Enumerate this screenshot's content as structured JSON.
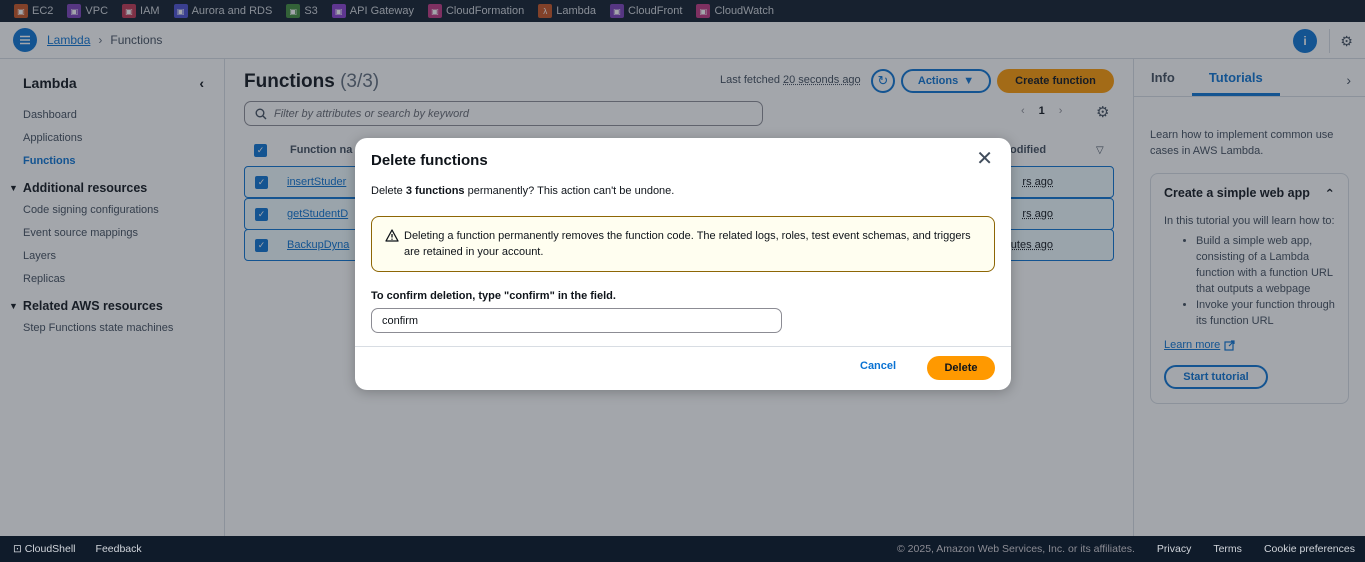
{
  "services": [
    {
      "label": "EC2",
      "icon": "ec2-icon",
      "color": "#c7511f"
    },
    {
      "label": "VPC",
      "icon": "vpc-icon",
      "color": "#7a3eb8"
    },
    {
      "label": "IAM",
      "icon": "iam-icon",
      "color": "#bf3450"
    },
    {
      "label": "Aurora and RDS",
      "icon": "rds-icon",
      "color": "#4a4fd1"
    },
    {
      "label": "S3",
      "icon": "s3-icon",
      "color": "#3e8a3a"
    },
    {
      "label": "API Gateway",
      "icon": "api-gateway-icon",
      "color": "#8a3fd1"
    },
    {
      "label": "CloudFormation",
      "icon": "cloudformation-icon",
      "color": "#bf3480"
    },
    {
      "label": "Lambda",
      "icon": "lambda-icon",
      "color": "#c7511f"
    },
    {
      "label": "CloudFront",
      "icon": "cloudfront-icon",
      "color": "#7a3eb8"
    },
    {
      "label": "CloudWatch",
      "icon": "cloudwatch-icon",
      "color": "#bf3480"
    }
  ],
  "breadcrumb": {
    "root": "Lambda",
    "current": "Functions"
  },
  "nav": {
    "title": "Lambda",
    "items": [
      "Dashboard",
      "Applications",
      "Functions"
    ],
    "active": "Functions",
    "additional_title": "Additional resources",
    "additional_items": [
      "Code signing configurations",
      "Event source mappings",
      "Layers",
      "Replicas"
    ],
    "related_title": "Related AWS resources",
    "related_items": [
      "Step Functions state machines"
    ]
  },
  "main": {
    "title": "Functions",
    "count": "(3/3)",
    "last_fetched_prefix": "Last fetched",
    "last_fetched_value": "20 seconds ago",
    "actions_label": "Actions",
    "create_label": "Create function",
    "filter_placeholder": "Filter by attributes or search by keyword",
    "page": "1",
    "col_name": "Function na",
    "col_modified": "odified",
    "rows": [
      {
        "name": "insertStuder",
        "modified": "rs ago"
      },
      {
        "name": "getStudentD",
        "modified": "rs ago"
      },
      {
        "name": "BackupDyna",
        "modified": "utes ago"
      }
    ]
  },
  "right_panel": {
    "tab_info": "Info",
    "tab_tutorials": "Tutorials",
    "intro": "Learn how to implement common use cases in AWS Lambda.",
    "card_title": "Create a simple web app",
    "card_text": "In this tutorial you will learn how to:",
    "bullets": [
      "Build a simple web app, consisting of a Lambda function with a function URL that outputs a webpage",
      "Invoke your function through its function URL"
    ],
    "learn_more": "Learn more",
    "start_label": "Start tutorial"
  },
  "modal": {
    "title": "Delete functions",
    "desc_prefix": "Delete",
    "desc_bold": "3 functions",
    "desc_suffix": "permanently? This action can't be undone.",
    "alert_text": "Deleting a function permanently removes the function code. The related logs, roles, test event schemas, and triggers are retained in your account.",
    "confirm_label": "To confirm deletion, type \"confirm\" in the field.",
    "confirm_value": "confirm",
    "cancel_label": "Cancel",
    "delete_label": "Delete"
  },
  "footer": {
    "cloudshell": "CloudShell",
    "feedback": "Feedback",
    "copyright": "© 2025, Amazon Web Services, Inc. or its affiliates.",
    "privacy": "Privacy",
    "terms": "Terms",
    "cookies": "Cookie preferences"
  },
  "colors": {
    "accent": "#0972d3",
    "primary_button": "#ff9900",
    "nav_dark": "#0f1b2a"
  }
}
